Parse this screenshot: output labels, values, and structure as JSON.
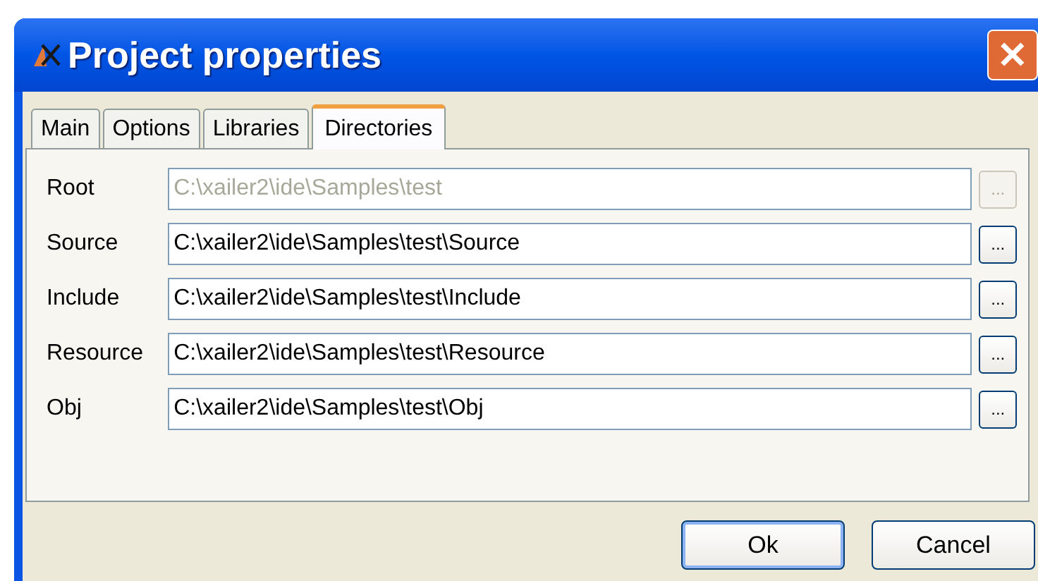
{
  "window": {
    "title": "Project properties",
    "close": "✕"
  },
  "tabs": [
    {
      "label": "Main",
      "selected": false
    },
    {
      "label": "Options",
      "selected": false
    },
    {
      "label": "Libraries",
      "selected": false
    },
    {
      "label": "Directories",
      "selected": true
    }
  ],
  "fields": [
    {
      "label": "Root",
      "value": "C:\\xailer2\\ide\\Samples\\test",
      "disabled": true,
      "browse": "..."
    },
    {
      "label": "Source",
      "value": "C:\\xailer2\\ide\\Samples\\test\\Source",
      "disabled": false,
      "browse": "..."
    },
    {
      "label": "Include",
      "value": "C:\\xailer2\\ide\\Samples\\test\\Include",
      "disabled": false,
      "browse": "..."
    },
    {
      "label": "Resource",
      "value": "C:\\xailer2\\ide\\Samples\\test\\Resource",
      "disabled": false,
      "browse": "..."
    },
    {
      "label": "Obj",
      "value": "C:\\xailer2\\ide\\Samples\\test\\Obj",
      "disabled": false,
      "browse": "..."
    }
  ],
  "buttons": [
    {
      "label": "Ok",
      "default": true
    },
    {
      "label": "Cancel",
      "default": false
    }
  ]
}
